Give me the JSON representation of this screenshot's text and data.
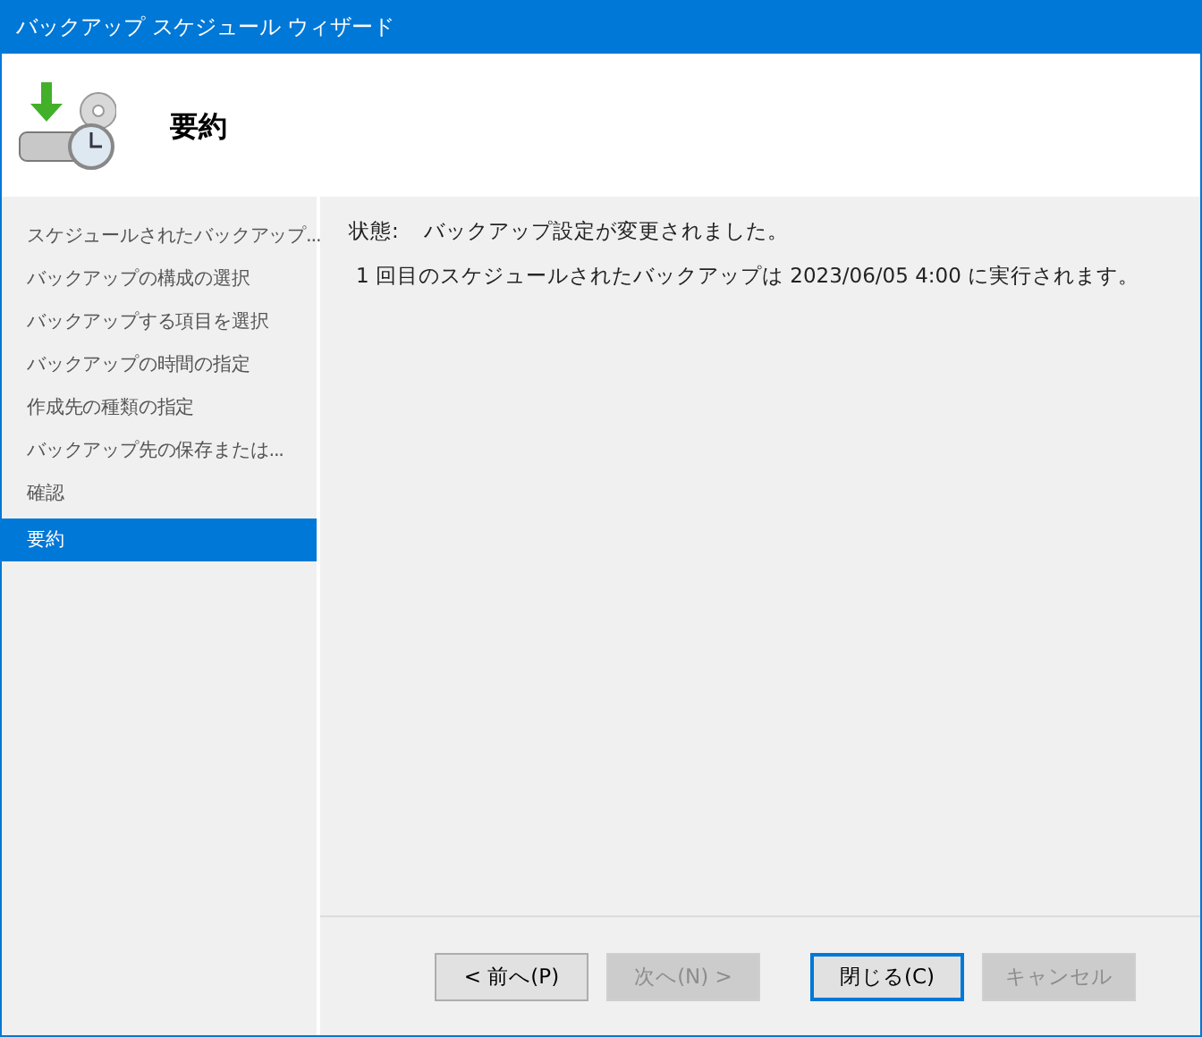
{
  "window": {
    "title": "バックアップ スケジュール ウィザード"
  },
  "header": {
    "title": "要約"
  },
  "sidebar": {
    "items": [
      {
        "label": "スケジュールされたバックアップ...",
        "selected": false
      },
      {
        "label": "バックアップの構成の選択",
        "selected": false
      },
      {
        "label": "バックアップする項目を選択",
        "selected": false
      },
      {
        "label": "バックアップの時間の指定",
        "selected": false
      },
      {
        "label": "作成先の種類の指定",
        "selected": false
      },
      {
        "label": "バックアップ先の保存または...",
        "selected": false
      },
      {
        "label": "確認",
        "selected": false
      },
      {
        "label": "要約",
        "selected": true
      }
    ]
  },
  "content": {
    "status_label": "状態:",
    "status_value": "バックアップ設定が変更されました。",
    "message": "1 回目のスケジュールされたバックアップは 2023/06/05 4:00 に実行されます。"
  },
  "buttons": [
    {
      "label": "< 前へ(P)",
      "disabled": false,
      "selected": false
    },
    {
      "label": "次へ(N) >",
      "disabled": true,
      "selected": false
    },
    {
      "label": "閉じる(C)",
      "disabled": false,
      "selected": true
    },
    {
      "label": "キャンセル",
      "disabled": true,
      "selected": false
    }
  ]
}
